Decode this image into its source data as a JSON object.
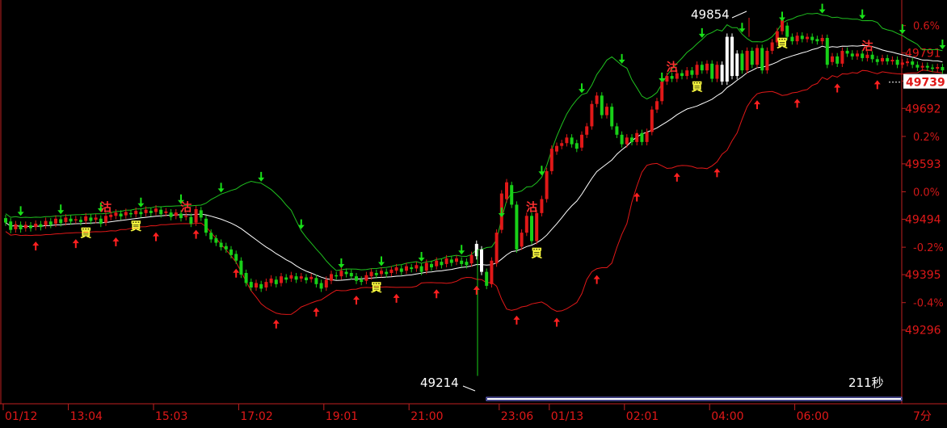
{
  "chart_data": {
    "type": "candlestick",
    "price_axis": {
      "labels": [
        "49791",
        "49692",
        "49593",
        "49494",
        "49395",
        "49296"
      ],
      "prices": [
        49791,
        49692,
        49593,
        49494,
        49395,
        49296
      ]
    },
    "percent_axis": {
      "labels": [
        "0.6%",
        "0.4%",
        "0.2%",
        "0.0%",
        "-0.2%",
        "-0.4%"
      ],
      "prices": [
        49840,
        49741,
        49642,
        49543,
        49444,
        49345
      ]
    },
    "ylim": [
      49170,
      49880
    ],
    "current_price": "49739",
    "high_label": "49854",
    "low_label": "49214",
    "timer_label": "211秒",
    "period_label": "7分",
    "time_axis": {
      "labels": [
        "01/12",
        "13:04",
        "15:03",
        "17:02",
        "19:01",
        "21:00",
        "23:06",
        "01/13",
        "02:01",
        "04:00",
        "06:00"
      ],
      "bar_index": [
        0,
        13,
        30,
        47,
        64,
        81,
        99,
        109,
        124,
        141,
        158
      ]
    },
    "bars": [
      {
        "o": 49496,
        "c": 49488
      },
      {
        "o": 49490,
        "c": 49475
      },
      {
        "o": 49476,
        "c": 49485
      },
      {
        "o": 49484,
        "c": 49476
      },
      {
        "o": 49478,
        "c": 49484
      },
      {
        "o": 49483,
        "c": 49478
      },
      {
        "o": 49480,
        "c": 49486
      },
      {
        "o": 49485,
        "c": 49480
      },
      {
        "o": 49483,
        "c": 49491
      },
      {
        "o": 49490,
        "c": 49484
      },
      {
        "o": 49486,
        "c": 49495
      },
      {
        "o": 49494,
        "c": 49487
      },
      {
        "o": 49489,
        "c": 49497
      },
      {
        "o": 49495,
        "c": 49490
      },
      {
        "o": 49492,
        "c": 49494
      },
      {
        "o": 49493,
        "c": 49489
      },
      {
        "o": 49491,
        "c": 49499
      },
      {
        "o": 49497,
        "c": 49491
      },
      {
        "o": 49493,
        "c": 49497
      },
      {
        "o": 49495,
        "c": 49486
      },
      {
        "o": 49488,
        "c": 49500
      },
      {
        "o": 49498,
        "c": 49502
      },
      {
        "o": 49500,
        "c": 49506
      },
      {
        "o": 49504,
        "c": 49499
      },
      {
        "o": 49501,
        "c": 49507
      },
      {
        "o": 49505,
        "c": 49503
      },
      {
        "o": 49503,
        "c": 49509
      },
      {
        "o": 49507,
        "c": 49503
      },
      {
        "o": 49505,
        "c": 49511
      },
      {
        "o": 49509,
        "c": 49505
      },
      {
        "o": 49507,
        "c": 49513
      },
      {
        "o": 49511,
        "c": 49503
      },
      {
        "o": 49505,
        "c": 49508
      },
      {
        "o": 49506,
        "c": 49498
      },
      {
        "o": 49500,
        "c": 49506
      },
      {
        "o": 49504,
        "c": 49496
      },
      {
        "o": 49498,
        "c": 49500
      },
      {
        "o": 49498,
        "c": 49486
      },
      {
        "o": 49488,
        "c": 49512
      },
      {
        "o": 49510,
        "c": 49497
      },
      {
        "o": 49495,
        "c": 49470
      },
      {
        "o": 49470,
        "c": 49458
      },
      {
        "o": 49460,
        "c": 49452
      },
      {
        "o": 49452,
        "c": 49444
      },
      {
        "o": 49446,
        "c": 49440
      },
      {
        "o": 49440,
        "c": 49430
      },
      {
        "o": 49432,
        "c": 49420
      },
      {
        "o": 49420,
        "c": 49395
      },
      {
        "o": 49398,
        "c": 49380
      },
      {
        "o": 49382,
        "c": 49372
      },
      {
        "o": 49372,
        "c": 49380
      },
      {
        "o": 49378,
        "c": 49370
      },
      {
        "o": 49372,
        "c": 49382
      },
      {
        "o": 49380,
        "c": 49388
      },
      {
        "o": 49386,
        "c": 49378
      },
      {
        "o": 49380,
        "c": 49392
      },
      {
        "o": 49390,
        "c": 49386
      },
      {
        "o": 49388,
        "c": 49394
      },
      {
        "o": 49392,
        "c": 49386
      },
      {
        "o": 49388,
        "c": 49392
      },
      {
        "o": 49390,
        "c": 49385
      },
      {
        "o": 49387,
        "c": 49391
      },
      {
        "o": 49389,
        "c": 49378
      },
      {
        "o": 49380,
        "c": 49370
      },
      {
        "o": 49372,
        "c": 49386
      },
      {
        "o": 49384,
        "c": 49396
      },
      {
        "o": 49394,
        "c": 49392
      },
      {
        "o": 49392,
        "c": 49402
      },
      {
        "o": 49400,
        "c": 49396
      },
      {
        "o": 49398,
        "c": 49392
      },
      {
        "o": 49392,
        "c": 49384
      },
      {
        "o": 49386,
        "c": 49382
      },
      {
        "o": 49384,
        "c": 49394
      },
      {
        "o": 49392,
        "c": 49400
      },
      {
        "o": 49398,
        "c": 49394
      },
      {
        "o": 49396,
        "c": 49402
      },
      {
        "o": 49400,
        "c": 49396
      },
      {
        "o": 49398,
        "c": 49404
      },
      {
        "o": 49402,
        "c": 49408
      },
      {
        "o": 49406,
        "c": 49400
      },
      {
        "o": 49402,
        "c": 49410
      },
      {
        "o": 49408,
        "c": 49405
      },
      {
        "o": 49406,
        "c": 49412
      },
      {
        "o": 49410,
        "c": 49400
      },
      {
        "o": 49402,
        "c": 49416
      },
      {
        "o": 49414,
        "c": 49408
      },
      {
        "o": 49410,
        "c": 49420
      },
      {
        "o": 49418,
        "c": 49412
      },
      {
        "o": 49414,
        "c": 49424
      },
      {
        "o": 49422,
        "c": 49416
      },
      {
        "o": 49418,
        "c": 49424
      },
      {
        "o": 49420,
        "c": 49414
      },
      {
        "o": 49418,
        "c": 49412
      },
      {
        "o": 49415,
        "c": 49430
      },
      {
        "o": 49428,
        "c": 49450,
        "w": 1
      },
      {
        "o": 49440,
        "c": 49400,
        "w": 1
      },
      {
        "o": 49400,
        "c": 49375
      },
      {
        "o": 49378,
        "c": 49420
      },
      {
        "o": 49415,
        "c": 49470
      },
      {
        "o": 49475,
        "c": 49540
      },
      {
        "o": 49530,
        "c": 49560
      },
      {
        "o": 49555,
        "c": 49520
      },
      {
        "o": 49520,
        "c": 49440
      },
      {
        "o": 49445,
        "c": 49470
      },
      {
        "o": 49470,
        "c": 49500
      },
      {
        "o": 49500,
        "c": 49455
      },
      {
        "o": 49455,
        "c": 49505
      },
      {
        "o": 49505,
        "c": 49530
      },
      {
        "o": 49530,
        "c": 49580
      },
      {
        "o": 49580,
        "c": 49620
      },
      {
        "o": 49615,
        "c": 49625
      },
      {
        "o": 49625,
        "c": 49630
      },
      {
        "o": 49630,
        "c": 49640
      },
      {
        "o": 49640,
        "c": 49628
      },
      {
        "o": 49630,
        "c": 49620
      },
      {
        "o": 49622,
        "c": 49645
      },
      {
        "o": 49645,
        "c": 49660
      },
      {
        "o": 49660,
        "c": 49700
      },
      {
        "o": 49700,
        "c": 49715
      },
      {
        "o": 49715,
        "c": 49680
      },
      {
        "o": 49680,
        "c": 49695
      },
      {
        "o": 49695,
        "c": 49660
      },
      {
        "o": 49660,
        "c": 49645
      },
      {
        "o": 49645,
        "c": 49628
      },
      {
        "o": 49628,
        "c": 49640
      },
      {
        "o": 49640,
        "c": 49632
      },
      {
        "o": 49632,
        "c": 49648
      },
      {
        "o": 49648,
        "c": 49632
      },
      {
        "o": 49632,
        "c": 49650
      },
      {
        "o": 49650,
        "c": 49690
      },
      {
        "o": 49690,
        "c": 49705
      },
      {
        "o": 49705,
        "c": 49740
      },
      {
        "o": 49740,
        "c": 49750
      },
      {
        "o": 49750,
        "c": 49745
      },
      {
        "o": 49745,
        "c": 49755
      },
      {
        "o": 49755,
        "c": 49750
      },
      {
        "o": 49750,
        "c": 49760
      },
      {
        "o": 49760,
        "c": 49752
      },
      {
        "o": 49752,
        "c": 49770
      },
      {
        "o": 49770,
        "c": 49760
      },
      {
        "o": 49760,
        "c": 49772
      },
      {
        "o": 49772,
        "c": 49745
      },
      {
        "o": 49745,
        "c": 49770
      },
      {
        "o": 49770,
        "c": 49740,
        "w": 1
      },
      {
        "o": 49740,
        "c": 49820,
        "w": 1
      },
      {
        "o": 49820,
        "c": 49750,
        "w": 1
      },
      {
        "o": 49750,
        "c": 49790,
        "w": 1
      },
      {
        "o": 49790,
        "c": 49760
      },
      {
        "o": 49760,
        "c": 49795
      },
      {
        "o": 49795,
        "c": 49770
      },
      {
        "o": 49770,
        "c": 49800
      },
      {
        "o": 49800,
        "c": 49760
      },
      {
        "o": 49760,
        "c": 49795
      },
      {
        "o": 49795,
        "c": 49810
      },
      {
        "o": 49810,
        "c": 49830
      },
      {
        "o": 49830,
        "c": 49850
      },
      {
        "o": 49840,
        "c": 49820
      },
      {
        "o": 49820,
        "c": 49812
      },
      {
        "o": 49812,
        "c": 49822
      },
      {
        "o": 49822,
        "c": 49816
      },
      {
        "o": 49816,
        "c": 49820
      },
      {
        "o": 49820,
        "c": 49814
      },
      {
        "o": 49816,
        "c": 49812
      },
      {
        "o": 49812,
        "c": 49818
      },
      {
        "o": 49818,
        "c": 49770
      },
      {
        "o": 49775,
        "c": 49785
      },
      {
        "o": 49785,
        "c": 49772
      },
      {
        "o": 49772,
        "c": 49795
      },
      {
        "o": 49795,
        "c": 49790
      },
      {
        "o": 49790,
        "c": 49785
      },
      {
        "o": 49785,
        "c": 49790
      },
      {
        "o": 49790,
        "c": 49782
      },
      {
        "o": 49782,
        "c": 49788
      },
      {
        "o": 49788,
        "c": 49780
      },
      {
        "o": 49780,
        "c": 49775
      },
      {
        "o": 49776,
        "c": 49782
      },
      {
        "o": 49782,
        "c": 49776
      },
      {
        "o": 49776,
        "c": 49779
      },
      {
        "o": 49779,
        "c": 49770
      },
      {
        "o": 49770,
        "c": 49774
      },
      {
        "o": 49773,
        "c": 49776
      },
      {
        "o": 49776,
        "c": 49770
      },
      {
        "o": 49770,
        "c": 49765
      },
      {
        "o": 49765,
        "c": 49768
      },
      {
        "o": 49768,
        "c": 49765
      },
      {
        "o": 49765,
        "c": 49763
      },
      {
        "o": 49763,
        "c": 49766
      },
      {
        "o": 49766,
        "c": 49760
      }
    ],
    "signals": [
      {
        "i": 16,
        "text": "買"
      },
      {
        "i": 20,
        "text": "沽"
      },
      {
        "i": 26,
        "text": "買"
      },
      {
        "i": 36,
        "text": "沽"
      },
      {
        "i": 74,
        "text": "買"
      },
      {
        "i": 105,
        "text": "沽"
      },
      {
        "i": 106,
        "text": "買"
      },
      {
        "i": 133,
        "text": "沽"
      },
      {
        "i": 138,
        "text": "買"
      },
      {
        "i": 155,
        "text": "買"
      },
      {
        "i": 172,
        "text": "沽"
      }
    ]
  }
}
